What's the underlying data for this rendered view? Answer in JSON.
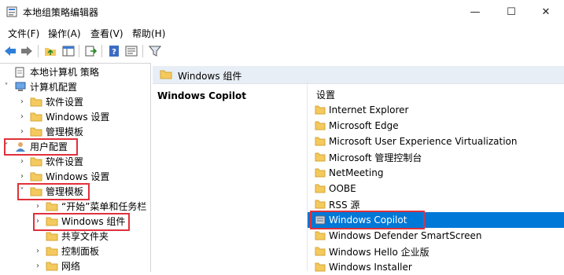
{
  "window": {
    "title": "本地组策略编辑器",
    "minimize_glyph": "—",
    "maximize_glyph": "☐",
    "close_glyph": "✕"
  },
  "menu": [
    "文件(F)",
    "操作(A)",
    "查看(V)",
    "帮助(H)"
  ],
  "toolbar_icons": [
    "back-arrow-icon",
    "forward-arrow-icon",
    "up-folder-icon",
    "show-tree-icon",
    "export-icon",
    "help-icon",
    "properties-icon",
    "filter-icon"
  ],
  "tree": {
    "items": [
      {
        "label": "本地计算机 策略",
        "icon": "document-icon"
      },
      {
        "label": "计算机配置",
        "icon": "computer-icon"
      },
      {
        "label": "软件设置",
        "icon": "folder-icon"
      },
      {
        "label": "Windows 设置",
        "icon": "folder-icon"
      },
      {
        "label": "管理模板",
        "icon": "folder-icon"
      },
      {
        "label": "用户配置",
        "icon": "user-icon"
      },
      {
        "label": "软件设置",
        "icon": "folder-icon"
      },
      {
        "label": "Windows 设置",
        "icon": "folder-icon"
      },
      {
        "label": "管理模板",
        "icon": "folder-icon"
      },
      {
        "label": "“开始”菜单和任务栏",
        "icon": "folder-icon"
      },
      {
        "label": "Windows 组件",
        "icon": "folder-icon"
      },
      {
        "label": "共享文件夹",
        "icon": "folder-icon"
      },
      {
        "label": "控制面板",
        "icon": "folder-icon"
      },
      {
        "label": "网络",
        "icon": "folder-icon"
      }
    ]
  },
  "right_header": {
    "label": "Windows 组件"
  },
  "description": {
    "title": "Windows Copilot"
  },
  "list": {
    "header": "设置",
    "items": [
      {
        "label": "Internet Explorer",
        "icon": "folder-icon"
      },
      {
        "label": "Microsoft Edge",
        "icon": "folder-icon"
      },
      {
        "label": "Microsoft User Experience Virtualization",
        "icon": "folder-icon"
      },
      {
        "label": "Microsoft 管理控制台",
        "icon": "folder-icon"
      },
      {
        "label": "NetMeeting",
        "icon": "folder-icon"
      },
      {
        "label": "OOBE",
        "icon": "folder-icon"
      },
      {
        "label": "RSS 源",
        "icon": "folder-icon"
      },
      {
        "label": "Windows Copilot",
        "icon": "policy-setting-icon",
        "selected": true
      },
      {
        "label": "Windows Defender SmartScreen",
        "icon": "folder-icon"
      },
      {
        "label": "Windows Hello 企业版",
        "icon": "folder-icon"
      },
      {
        "label": "Windows Installer",
        "icon": "folder-icon"
      }
    ]
  },
  "colors": {
    "selection": "#0078d7",
    "highlight_box": "#e0313b",
    "folder": "#f4c95d"
  }
}
